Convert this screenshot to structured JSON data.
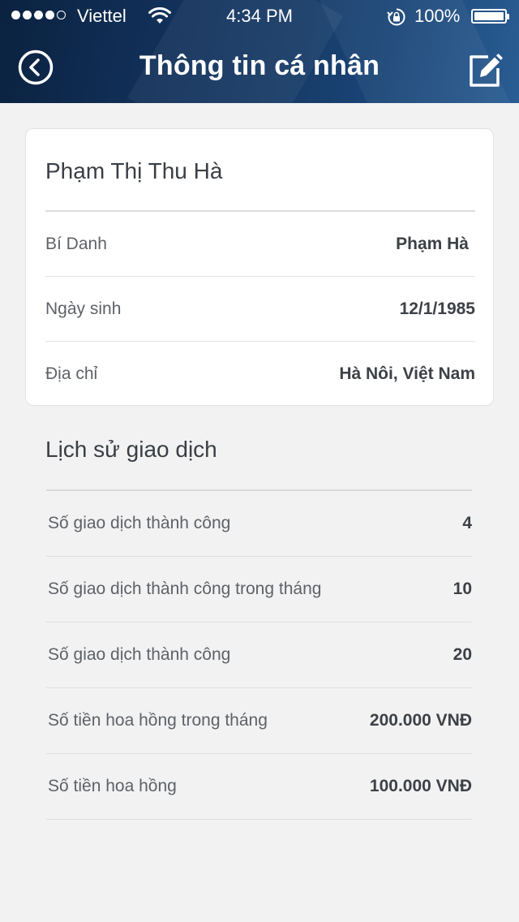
{
  "status_bar": {
    "carrier": "Viettel",
    "time": "4:34 PM",
    "battery": "100%",
    "signal_bars_filled": 4,
    "signal_bars_total": 5
  },
  "header": {
    "title": "Thông tin cá nhân",
    "back_icon": "back-circle-arrow-icon",
    "edit_icon": "edit-pencil-icon",
    "gradient_colors": [
      "#0b2240",
      "#173a66",
      "#2a5d93"
    ]
  },
  "profile": {
    "full_name": "Phạm Thị Thu Hà",
    "rows": [
      {
        "label": "Bí Danh",
        "value": "Phạm Hà"
      },
      {
        "label": "Ngày sinh",
        "value": "12/1/1985"
      },
      {
        "label": "Địa chỉ",
        "value": "Hà Nôi, Việt Nam"
      }
    ]
  },
  "history": {
    "title": "Lịch sử giao dịch",
    "rows": [
      {
        "label": "Số giao dịch thành công",
        "value": "4"
      },
      {
        "label": "Số giao dịch thành công trong tháng",
        "value": "10"
      },
      {
        "label": "Số giao dịch thành công",
        "value": "20"
      },
      {
        "label": "Số tiền hoa hồng trong tháng",
        "value": "200.000 VNĐ"
      },
      {
        "label": "Số tiền hoa hồng",
        "value": "100.000 VNĐ"
      }
    ]
  }
}
